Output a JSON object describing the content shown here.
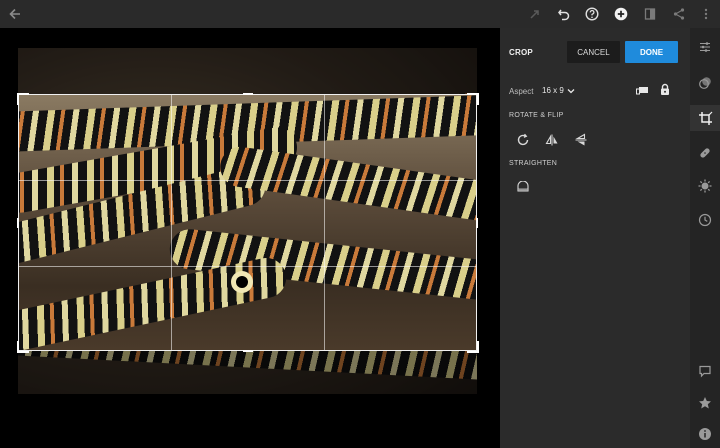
{
  "toolbar": {
    "icons": [
      "back-arrow-icon",
      "redo-icon",
      "undo-icon",
      "help-icon",
      "add-icon",
      "compare-icon",
      "share-icon",
      "more-icon"
    ]
  },
  "panel": {
    "title": "CROP",
    "cancel_label": "CANCEL",
    "done_label": "DONE",
    "aspect_label": "Aspect",
    "aspect_value": "16 x 9",
    "rotate_flip_label": "ROTATE & FLIP",
    "straighten_label": "STRAIGHTEN"
  },
  "rail": {
    "icons": [
      "sliders-icon",
      "presets-icon",
      "crop-icon",
      "healing-icon",
      "effects-icon",
      "history-icon",
      "comment-icon",
      "star-icon",
      "info-icon"
    ],
    "active": "crop-icon"
  },
  "colors": {
    "accent": "#1f8bdc",
    "panel": "#2b2b2b",
    "toolbar": "#2a2a2a"
  }
}
